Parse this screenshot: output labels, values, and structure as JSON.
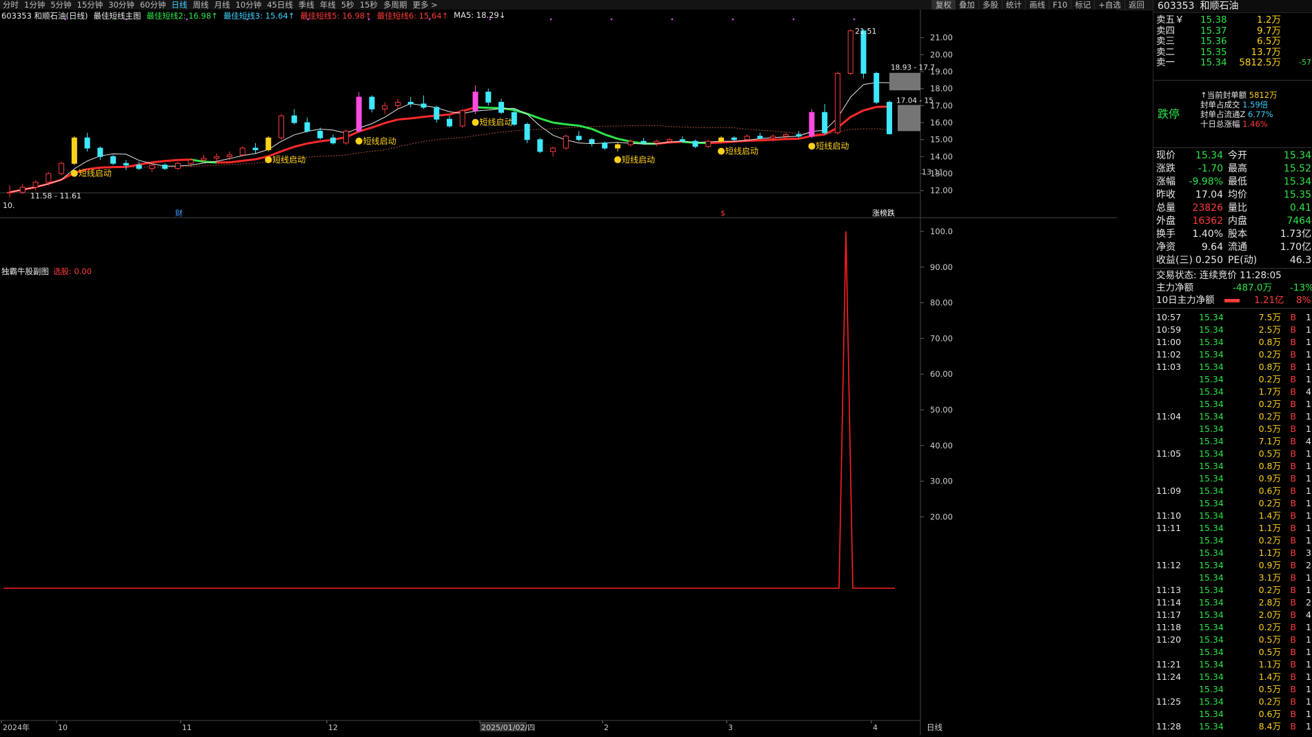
{
  "toolbar": {
    "periods": [
      "分时",
      "1分钟",
      "5分钟",
      "15分钟",
      "30分钟",
      "60分钟",
      "日线",
      "周线",
      "月线",
      "10分钟",
      "45日线",
      "季线",
      "年线",
      "5秒",
      "15秒",
      "多周期",
      "更多 >"
    ],
    "active_period": "日线",
    "tools": [
      "复权",
      "叠加",
      "多股",
      "统计",
      "画线",
      "F10",
      "标记",
      "+自选",
      "返回"
    ]
  },
  "chart_header": {
    "stock": "603353 和顺石油(日线)",
    "indicator": "最佳短线主图",
    "lines": [
      {
        "text": "最佳短线2: 16.98↑",
        "color": "#2ee44a"
      },
      {
        "text": "最佳短线3: 15.64↑",
        "color": "#3fd0ff"
      },
      {
        "text": "最佳短线5: 16.98↑",
        "color": "#ff3b3b"
      },
      {
        "text": "最佳短线6: 15.64↑",
        "color": "#ff3b3b"
      },
      {
        "text": "MA5: 18.29↓",
        "color": "#e8e8e8"
      }
    ]
  },
  "price_axis": {
    "ticks": [
      "21.00",
      "20.00",
      "19.00",
      "18.00",
      "17.00",
      "16.00",
      "15.00",
      "14.00",
      "13.00",
      "12.00"
    ],
    "current_label": "13.11"
  },
  "price_annotations": {
    "high_label": "21.51",
    "box_upper": "18.93 - 17.7",
    "box_lower": "17.04 - 15",
    "low_range": "11.58 - 11.61",
    "low_marker": "10."
  },
  "signal_label": "短线启动",
  "event_markers": [
    {
      "text": "财",
      "color": "#3fa0ff"
    },
    {
      "text": "$",
      "color": "#ff3b3b"
    },
    {
      "text": "涨榜跌",
      "color": "#ffffff"
    }
  ],
  "indicator_panel": {
    "name": "独霸牛股副图",
    "value_label": "选股: 0.00",
    "axis": [
      "100.0",
      "90.00",
      "80.00",
      "70.00",
      "60.00",
      "50.00",
      "40.00",
      "30.00",
      "20.00"
    ]
  },
  "date_axis": {
    "labels": [
      "2024年",
      "10",
      "11",
      "12",
      "2025/01/02/四",
      "2",
      "3",
      "4"
    ],
    "period": "日线"
  },
  "chart_data": {
    "type": "candlestick",
    "title": "603353 和顺石油(日线)",
    "y_range": [
      11.5,
      22
    ],
    "series_note": "daily OHLC approximations read from chart",
    "ohlc": [
      [
        11.9,
        12.3,
        11.6,
        11.9
      ],
      [
        11.9,
        12.4,
        11.8,
        12.2
      ],
      [
        12.2,
        12.6,
        12.0,
        12.5
      ],
      [
        12.5,
        13.1,
        12.3,
        13.0
      ],
      [
        13.0,
        13.7,
        12.9,
        13.6
      ],
      [
        13.6,
        15.2,
        13.5,
        15.1
      ],
      [
        15.1,
        15.4,
        14.3,
        14.5
      ],
      [
        14.5,
        14.6,
        13.8,
        14.0
      ],
      [
        14.0,
        14.1,
        13.5,
        13.6
      ],
      [
        13.6,
        13.8,
        13.2,
        13.5
      ],
      [
        13.5,
        13.7,
        13.2,
        13.3
      ],
      [
        13.3,
        13.6,
        13.1,
        13.5
      ],
      [
        13.5,
        13.6,
        13.2,
        13.3
      ],
      [
        13.3,
        13.7,
        13.2,
        13.6
      ],
      [
        13.6,
        13.9,
        13.4,
        13.8
      ],
      [
        13.8,
        14.1,
        13.6,
        13.9
      ],
      [
        13.9,
        14.2,
        13.7,
        14.0
      ],
      [
        14.0,
        14.3,
        13.8,
        14.1
      ],
      [
        14.1,
        14.6,
        14.0,
        14.5
      ],
      [
        14.5,
        14.8,
        14.2,
        14.4
      ],
      [
        14.4,
        15.2,
        14.3,
        15.1
      ],
      [
        15.1,
        16.5,
        15.0,
        16.4
      ],
      [
        16.4,
        16.8,
        15.9,
        16.0
      ],
      [
        16.0,
        16.3,
        15.4,
        15.5
      ],
      [
        15.5,
        15.7,
        15.0,
        15.1
      ],
      [
        15.1,
        15.3,
        14.7,
        14.8
      ],
      [
        14.8,
        15.6,
        14.7,
        15.5
      ],
      [
        15.5,
        17.8,
        15.4,
        17.5
      ],
      [
        17.5,
        17.6,
        16.6,
        16.8
      ],
      [
        16.8,
        17.2,
        16.5,
        17.0
      ],
      [
        17.0,
        17.4,
        16.8,
        17.2
      ],
      [
        17.2,
        17.5,
        16.9,
        17.1
      ],
      [
        17.1,
        17.6,
        16.8,
        16.9
      ],
      [
        16.9,
        17.0,
        16.0,
        16.2
      ],
      [
        16.2,
        16.4,
        15.7,
        15.8
      ],
      [
        15.8,
        16.8,
        15.7,
        16.7
      ],
      [
        16.7,
        18.2,
        16.5,
        17.8
      ],
      [
        17.8,
        18.0,
        17.0,
        17.2
      ],
      [
        17.2,
        17.4,
        16.5,
        16.6
      ],
      [
        16.6,
        16.8,
        15.8,
        15.9
      ],
      [
        15.9,
        16.0,
        14.8,
        15.0
      ],
      [
        15.0,
        15.1,
        14.2,
        14.3
      ],
      [
        14.3,
        14.6,
        14.0,
        14.5
      ],
      [
        14.5,
        15.3,
        14.4,
        15.2
      ],
      [
        15.2,
        15.5,
        14.9,
        15.0
      ],
      [
        15.0,
        15.1,
        14.6,
        14.8
      ],
      [
        14.8,
        14.9,
        14.4,
        14.5
      ],
      [
        14.5,
        14.8,
        14.3,
        14.7
      ],
      [
        14.7,
        15.0,
        14.6,
        14.9
      ],
      [
        14.9,
        15.1,
        14.7,
        14.8
      ],
      [
        14.8,
        15.0,
        14.6,
        14.9
      ],
      [
        14.9,
        15.1,
        14.8,
        15.0
      ],
      [
        15.0,
        15.2,
        14.8,
        14.9
      ],
      [
        14.9,
        15.0,
        14.5,
        14.6
      ],
      [
        14.6,
        15.0,
        14.5,
        14.9
      ],
      [
        14.9,
        15.2,
        14.8,
        15.1
      ],
      [
        15.1,
        15.2,
        14.9,
        15.0
      ],
      [
        15.0,
        15.3,
        14.9,
        15.2
      ],
      [
        15.2,
        15.4,
        15.0,
        15.1
      ],
      [
        15.1,
        15.3,
        14.9,
        15.2
      ],
      [
        15.2,
        15.4,
        15.0,
        15.3
      ],
      [
        15.3,
        15.5,
        15.1,
        15.2
      ],
      [
        15.2,
        16.8,
        15.1,
        16.6
      ],
      [
        16.6,
        17.1,
        15.3,
        15.4
      ],
      [
        15.4,
        19.0,
        15.3,
        18.9
      ],
      [
        18.9,
        21.5,
        18.8,
        21.4
      ],
      [
        21.4,
        21.5,
        18.6,
        18.9
      ],
      [
        18.9,
        19.0,
        17.1,
        17.2
      ],
      [
        17.2,
        17.3,
        15.3,
        15.34
      ]
    ]
  },
  "panel": {
    "code": "603353",
    "name": "和顺石油",
    "asks": [
      {
        "label": "卖五￥",
        "price": "15.38",
        "vol": "1.2万"
      },
      {
        "label": "卖四",
        "price": "15.37",
        "vol": "9.7万"
      },
      {
        "label": "卖三",
        "price": "15.36",
        "vol": "6.5万"
      },
      {
        "label": "卖二",
        "price": "15.35",
        "vol": "13.7万"
      },
      {
        "label": "卖一",
        "price": "15.34",
        "vol": "5812.5万",
        "extra": "-57"
      }
    ],
    "limit": {
      "status": "跌停",
      "rows": [
        {
          "k": "↑当前封单额",
          "v": "5812万"
        },
        {
          "k": "封单占成交",
          "v": "1.59倍"
        },
        {
          "k": "封单占流通Z",
          "v": "6.77%"
        },
        {
          "k": "十日总涨幅",
          "v": "1.46%"
        }
      ]
    },
    "quote": [
      {
        "k1": "现价",
        "v1": "15.34",
        "k2": "今开",
        "v2": "15.34"
      },
      {
        "k1": "涨跌",
        "v1": "-1.70",
        "k2": "最高",
        "v2": "15.52"
      },
      {
        "k1": "涨幅",
        "v1": "-9.98%",
        "k2": "最低",
        "v2": "15.34"
      },
      {
        "k1": "昨收",
        "v1": "17.04",
        "k2": "均价",
        "v2": "15.35"
      },
      {
        "k1": "总量",
        "v1": "23826",
        "k2": "量比",
        "v2": "0.41"
      },
      {
        "k1": "外盘",
        "v1": "16362",
        "k2": "内盘",
        "v2": "7464"
      },
      {
        "k1": "换手",
        "v1": "1.40%",
        "k2": "股本",
        "v2": "1.73亿"
      },
      {
        "k1": "净资",
        "v1": "9.64",
        "k2": "流通",
        "v2": "1.70亿"
      },
      {
        "k1": "收益(三)",
        "v1": "0.250",
        "k2": "PE(动)",
        "v2": "46.3"
      }
    ],
    "status_text": "交易状态: 连续竞价 11:28:05",
    "main_net": {
      "label": "主力净额",
      "value": "-487.0万",
      "pct": "-13%"
    },
    "ten_day_net": {
      "label": "10日主力净额",
      "value": "1.21亿",
      "pct": "8%"
    },
    "ticks": [
      {
        "time": "10:57",
        "price": "15.34",
        "vol": "7.5万",
        "side": "B",
        "n": "1"
      },
      {
        "time": "10:59",
        "price": "15.34",
        "vol": "2.5万",
        "side": "B",
        "n": "1"
      },
      {
        "time": "11:00",
        "price": "15.34",
        "vol": "0.8万",
        "side": "B",
        "n": "1"
      },
      {
        "time": "11:02",
        "price": "15.34",
        "vol": "0.2万",
        "side": "B",
        "n": "1"
      },
      {
        "time": "11:03",
        "price": "15.34",
        "vol": "0.8万",
        "side": "B",
        "n": "1"
      },
      {
        "time": "",
        "price": "15.34",
        "vol": "0.2万",
        "side": "B",
        "n": "1"
      },
      {
        "time": "",
        "price": "15.34",
        "vol": "1.7万",
        "side": "B",
        "n": "4"
      },
      {
        "time": "",
        "price": "15.34",
        "vol": "0.2万",
        "side": "B",
        "n": "1"
      },
      {
        "time": "11:04",
        "price": "15.34",
        "vol": "0.2万",
        "side": "B",
        "n": "1"
      },
      {
        "time": "",
        "price": "15.34",
        "vol": "0.5万",
        "side": "B",
        "n": "1"
      },
      {
        "time": "",
        "price": "15.34",
        "vol": "7.1万",
        "side": "B",
        "n": "4"
      },
      {
        "time": "11:05",
        "price": "15.34",
        "vol": "0.5万",
        "side": "B",
        "n": "1"
      },
      {
        "time": "",
        "price": "15.34",
        "vol": "0.8万",
        "side": "B",
        "n": "1"
      },
      {
        "time": "",
        "price": "15.34",
        "vol": "0.9万",
        "side": "B",
        "n": "1"
      },
      {
        "time": "11:09",
        "price": "15.34",
        "vol": "0.6万",
        "side": "B",
        "n": "1"
      },
      {
        "time": "",
        "price": "15.34",
        "vol": "0.2万",
        "side": "B",
        "n": "1"
      },
      {
        "time": "11:10",
        "price": "15.34",
        "vol": "1.4万",
        "side": "B",
        "n": "1"
      },
      {
        "time": "11:11",
        "price": "15.34",
        "vol": "1.1万",
        "side": "B",
        "n": "1"
      },
      {
        "time": "",
        "price": "15.34",
        "vol": "0.2万",
        "side": "B",
        "n": "1"
      },
      {
        "time": "",
        "price": "15.34",
        "vol": "1.1万",
        "side": "B",
        "n": "3"
      },
      {
        "time": "11:12",
        "price": "15.34",
        "vol": "0.9万",
        "side": "B",
        "n": "2"
      },
      {
        "time": "",
        "price": "15.34",
        "vol": "3.1万",
        "side": "B",
        "n": "1"
      },
      {
        "time": "11:13",
        "price": "15.34",
        "vol": "0.2万",
        "side": "B",
        "n": "1"
      },
      {
        "time": "11:14",
        "price": "15.34",
        "vol": "2.8万",
        "side": "B",
        "n": "2"
      },
      {
        "time": "11:17",
        "price": "15.34",
        "vol": "2.0万",
        "side": "B",
        "n": "4"
      },
      {
        "time": "11:18",
        "price": "15.34",
        "vol": "0.2万",
        "side": "B",
        "n": "1"
      },
      {
        "time": "11:20",
        "price": "15.34",
        "vol": "0.5万",
        "side": "B",
        "n": "1"
      },
      {
        "time": "",
        "price": "15.34",
        "vol": "0.5万",
        "side": "B",
        "n": "1"
      },
      {
        "time": "11:21",
        "price": "15.34",
        "vol": "1.1万",
        "side": "B",
        "n": "1"
      },
      {
        "time": "11:24",
        "price": "15.34",
        "vol": "1.4万",
        "side": "B",
        "n": "1"
      },
      {
        "time": "",
        "price": "15.34",
        "vol": "0.5万",
        "side": "B",
        "n": "1"
      },
      {
        "time": "11:25",
        "price": "15.34",
        "vol": "0.2万",
        "side": "B",
        "n": "1"
      },
      {
        "time": "",
        "price": "15.34",
        "vol": "0.6万",
        "side": "B",
        "n": "1"
      },
      {
        "time": "11:28",
        "price": "15.34",
        "vol": "8.4万",
        "side": "B",
        "n": "1"
      }
    ]
  }
}
